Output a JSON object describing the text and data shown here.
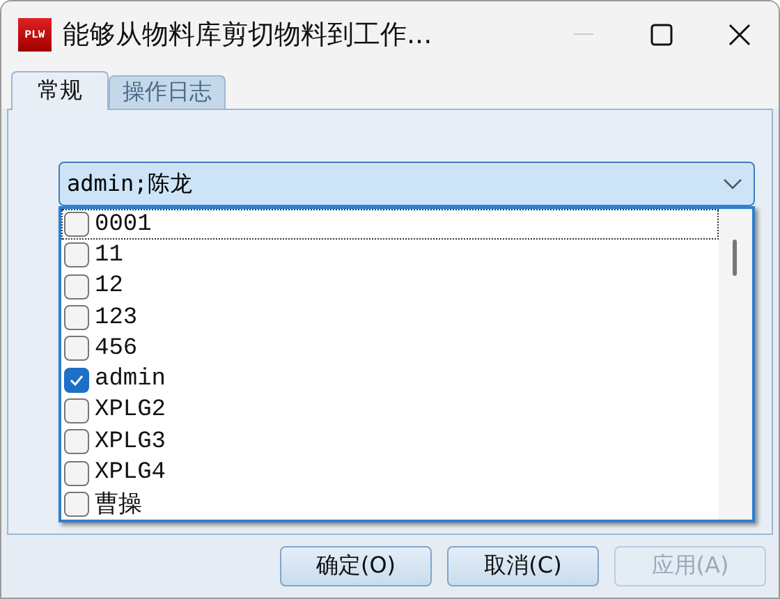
{
  "window": {
    "icon_text": "PLW",
    "title": "能够从物料库剪切物料到工作..."
  },
  "tabs": [
    {
      "label": "常规",
      "selected": true
    },
    {
      "label": "操作日志",
      "selected": false
    }
  ],
  "combo": {
    "value": "admin;陈龙",
    "expanded": true
  },
  "options": [
    {
      "label": "0001",
      "checked": false,
      "focused": true
    },
    {
      "label": "11",
      "checked": false,
      "focused": false
    },
    {
      "label": "12",
      "checked": false,
      "focused": false
    },
    {
      "label": "123",
      "checked": false,
      "focused": false
    },
    {
      "label": "456",
      "checked": false,
      "focused": false
    },
    {
      "label": "admin",
      "checked": true,
      "focused": false
    },
    {
      "label": "XPLG2",
      "checked": false,
      "focused": false
    },
    {
      "label": "XPLG3",
      "checked": false,
      "focused": false
    },
    {
      "label": "XPLG4",
      "checked": false,
      "focused": false
    },
    {
      "label": "曹操",
      "checked": false,
      "focused": false
    }
  ],
  "buttons": [
    {
      "label": "确定(O)",
      "disabled": false
    },
    {
      "label": "取消(C)",
      "disabled": false
    },
    {
      "label": "应用(A)",
      "disabled": true
    }
  ]
}
